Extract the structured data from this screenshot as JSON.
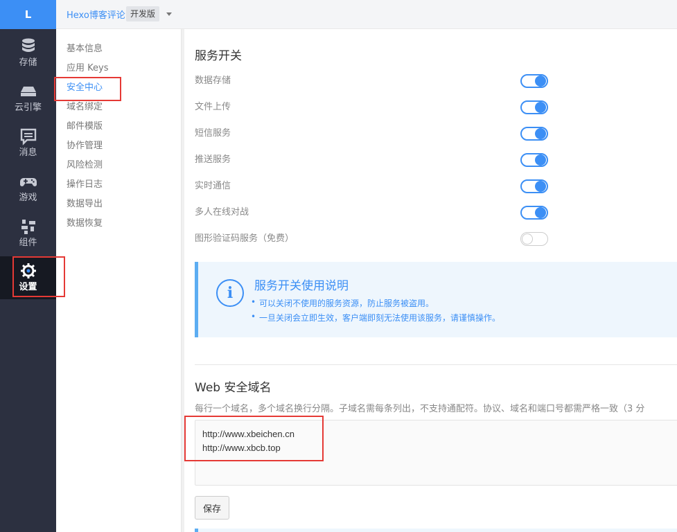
{
  "rail": {
    "logo": "L",
    "items": [
      {
        "label": "存储",
        "icon": "database-icon"
      },
      {
        "label": "云引擎",
        "icon": "cloud-engine-icon"
      },
      {
        "label": "消息",
        "icon": "message-icon"
      },
      {
        "label": "游戏",
        "icon": "gamepad-icon"
      },
      {
        "label": "组件",
        "icon": "components-icon"
      },
      {
        "label": "设置",
        "icon": "gear-icon",
        "active": true
      }
    ]
  },
  "topbar": {
    "app_name": "Hexo博客评论",
    "env_badge": "开发版"
  },
  "subnav": {
    "items": [
      "基本信息",
      "应用 Keys",
      "安全中心",
      "域名绑定",
      "邮件模版",
      "协作管理",
      "风险检测",
      "操作日志",
      "数据导出",
      "数据恢复"
    ],
    "active": "安全中心"
  },
  "services": {
    "title": "服务开关",
    "items": [
      {
        "label": "数据存储",
        "enabled": true
      },
      {
        "label": "文件上传",
        "enabled": true
      },
      {
        "label": "短信服务",
        "enabled": true
      },
      {
        "label": "推送服务",
        "enabled": true
      },
      {
        "label": "实时通信",
        "enabled": true
      },
      {
        "label": "多人在线对战",
        "enabled": true
      },
      {
        "label": "图形验证码服务（免费）",
        "enabled": false
      }
    ]
  },
  "info": {
    "icon": "info-icon",
    "title": "服务开关使用说明",
    "lines": [
      "可以关闭不使用的服务资源，防止服务被盗用。",
      "一旦关闭会立即生效，客户端即刻无法使用该服务，请谨慎操作。"
    ]
  },
  "web_domain": {
    "title": "Web 安全域名",
    "description": "每行一个域名，多个域名换行分隔。子域名需每条列出，不支持通配符。协议、域名和端口号都需严格一致（3 分",
    "value": "http://www.xbeichen.cn\nhttp://www.xbcb.top",
    "save_label": "保存"
  },
  "colors": {
    "accent": "#3c8ff5",
    "rail_bg": "#2c3040",
    "highlight": "#e53935"
  }
}
